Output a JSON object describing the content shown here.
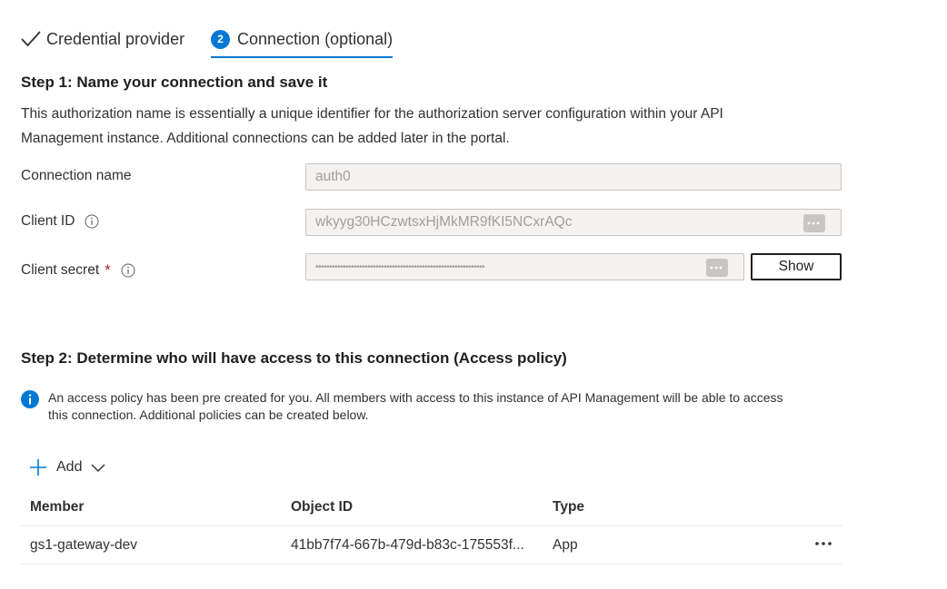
{
  "tabs": [
    {
      "label": "Credential provider",
      "state": "completed"
    },
    {
      "label": "Connection (optional)",
      "number": "2",
      "state": "active"
    }
  ],
  "step1": {
    "heading": "Step 1: Name your connection and save it",
    "description": "This authorization name is essentially a unique identifier for the authorization server configuration within your API Management instance. Additional connections can be added later in the portal."
  },
  "form": {
    "connection_name": {
      "label": "Connection name",
      "value": "auth0"
    },
    "client_id": {
      "label": "Client ID",
      "value": "wkyyg30HCzwtsxHjMkMR9fKI5NCxrAQc"
    },
    "client_secret": {
      "label": "Client secret",
      "required_marker": "*",
      "value": "••••••••••••••••••••••••••••••••••••••••••••••••••••••••••••••",
      "show_label": "Show"
    }
  },
  "step2": {
    "heading": "Step 2: Determine who will have access to this connection (Access policy)",
    "info_text": "An access policy has been pre created for you. All members with access to this instance of API Management will be able to access this connection. Additional policies can be created below."
  },
  "toolbar": {
    "add_label": "Add"
  },
  "table": {
    "columns": [
      "Member",
      "Object ID",
      "Type"
    ],
    "rows": [
      {
        "member": "gs1-gateway-dev",
        "object_id": "41bb7f74-667b-479d-b83c-175553f...",
        "type": "App"
      }
    ]
  },
  "colors": {
    "accent": "#0078d4",
    "required": "#a4262c",
    "disabled_field": "#f3f2f1"
  },
  "icons": [
    "checkmark-icon",
    "info-icon",
    "info-filled-icon",
    "plus-icon",
    "chevron-down-icon",
    "more-icon",
    "ellipsis-icon"
  ]
}
